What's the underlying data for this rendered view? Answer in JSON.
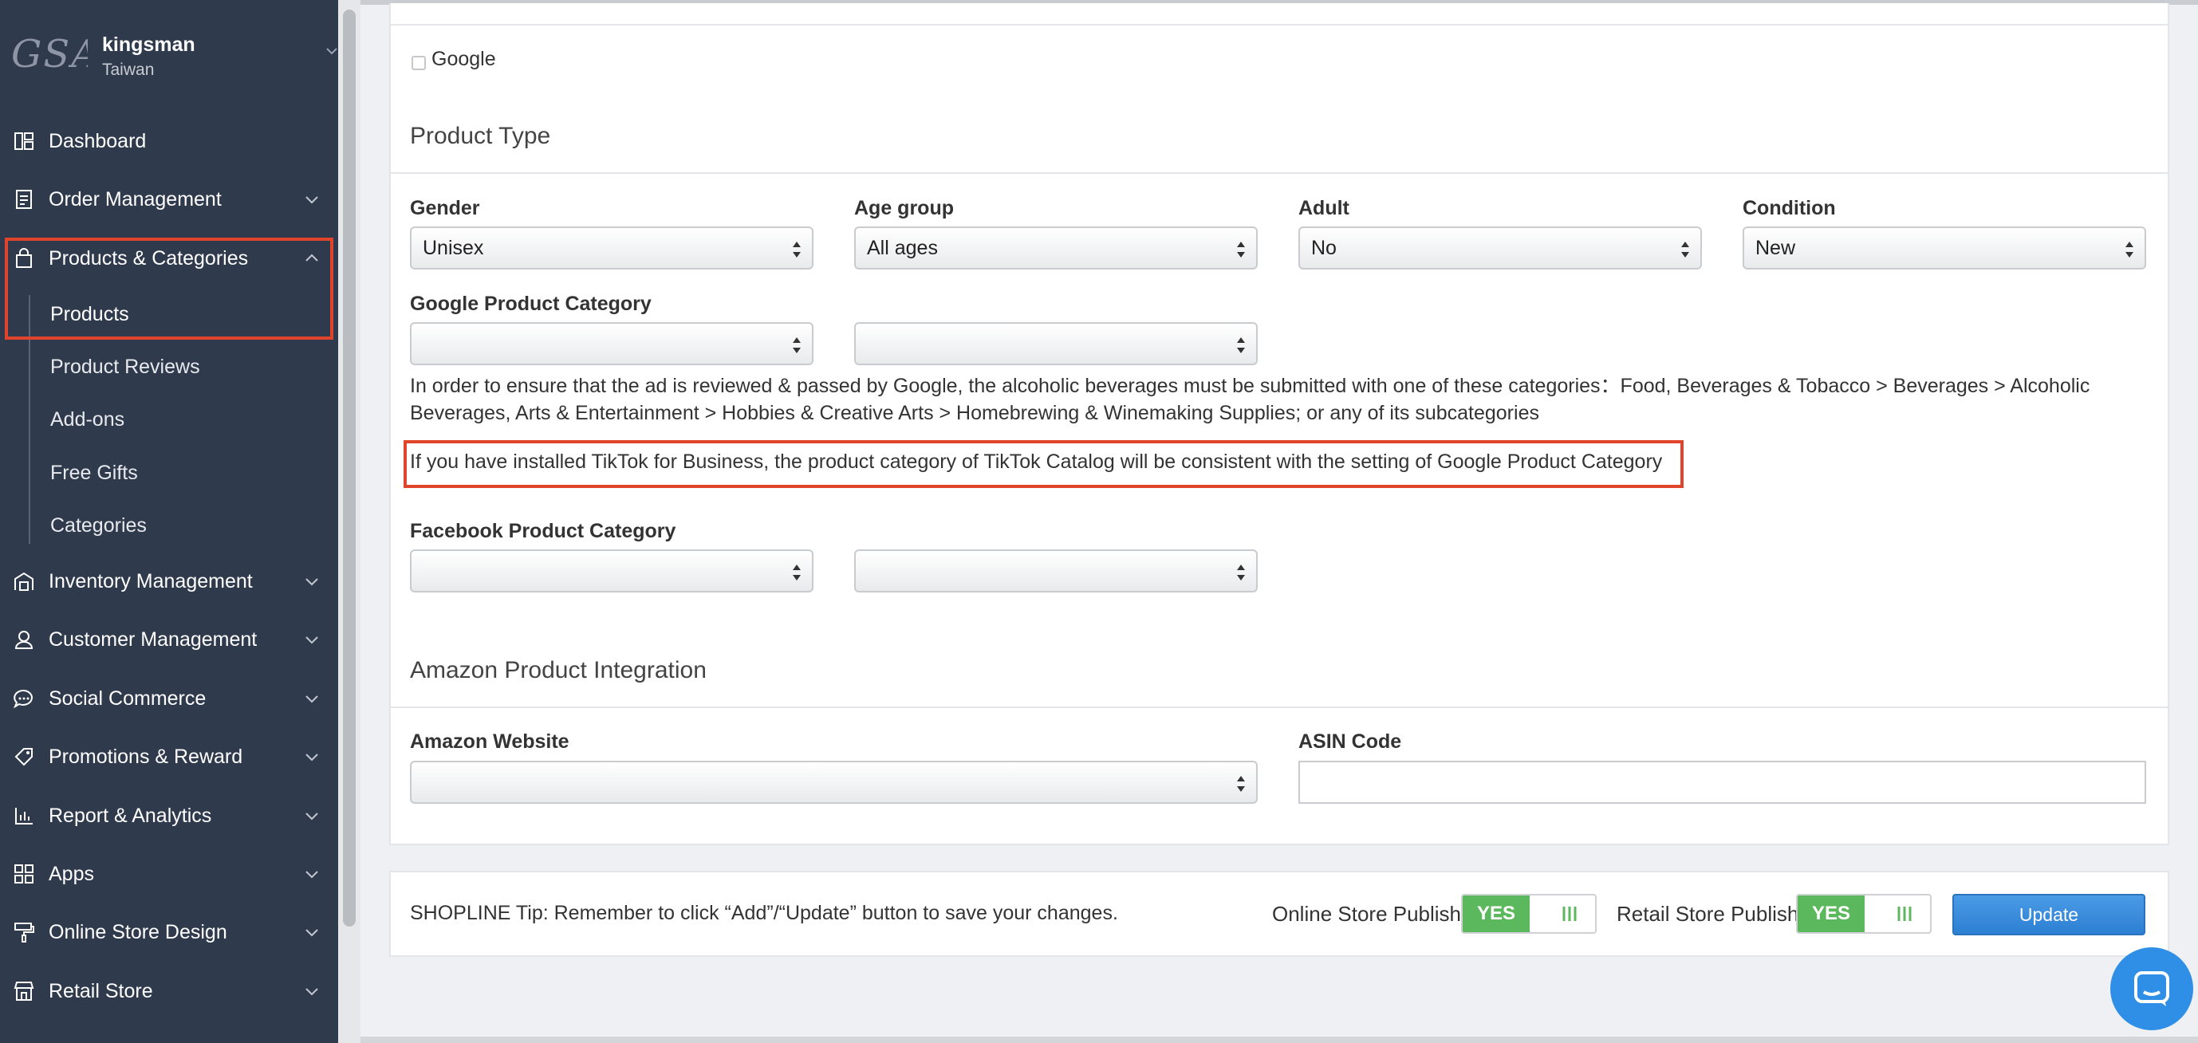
{
  "store": {
    "logo_text": "GSA",
    "name": "kingsman",
    "region": "Taiwan"
  },
  "sidebar": {
    "items": [
      {
        "label": "Dashboard",
        "icon": "dashboard-icon"
      },
      {
        "label": "Order Management",
        "icon": "clipboard-icon"
      },
      {
        "label": "Products & Categories",
        "icon": "shopping-bag-icon"
      },
      {
        "label": "Inventory Management",
        "icon": "warehouse-icon"
      },
      {
        "label": "Customer Management",
        "icon": "user-icon"
      },
      {
        "label": "Social Commerce",
        "icon": "chat-icon"
      },
      {
        "label": "Promotions & Reward",
        "icon": "tag-icon"
      },
      {
        "label": "Report & Analytics",
        "icon": "chart-icon"
      },
      {
        "label": "Apps",
        "icon": "apps-icon"
      },
      {
        "label": "Online Store Design",
        "icon": "paint-roller-icon"
      },
      {
        "label": "Retail Store",
        "icon": "store-icon"
      }
    ],
    "subitems": [
      "Products",
      "Product Reviews",
      "Add-ons",
      "Free Gifts",
      "Categories"
    ]
  },
  "channels": {
    "google_label": "Google"
  },
  "product_type": {
    "title": "Product Type",
    "gender": {
      "label": "Gender",
      "value": "Unisex"
    },
    "age_group": {
      "label": "Age group",
      "value": "All ages"
    },
    "adult": {
      "label": "Adult",
      "value": "No"
    },
    "condition": {
      "label": "Condition",
      "value": "New"
    },
    "google_category": {
      "label": "Google Product Category",
      "help": "In order to ensure that the ad is reviewed & passed by Google, the alcoholic beverages must be submitted with one of these categories：Food, Beverages & Tobacco > Beverages > Alcoholic Beverages, Arts & Entertainment > Hobbies & Creative Arts > Homebrewing & Winemaking Supplies; or any of its subcategories",
      "tiktok_note": "If you have installed TikTok for Business, the product category of TikTok Catalog will be consistent with the setting of Google Product Category"
    },
    "facebook_category": {
      "label": "Facebook Product Category"
    }
  },
  "amazon": {
    "title": "Amazon Product Integration",
    "website_label": "Amazon Website",
    "asin_label": "ASIN Code",
    "asin_value": ""
  },
  "footer": {
    "tip": "SHOPLINE Tip: Remember to click “Add”/“Update” button to save your changes.",
    "online_publish_label": "Online Store Publish",
    "online_publish_state": "YES",
    "retail_publish_label": "Retail Store Publish",
    "retail_publish_state": "YES",
    "update_label": "Update"
  },
  "colors": {
    "sidebar_bg": "#2f3a4c",
    "highlight": "#e0442b",
    "toggle_on": "#5cb85c",
    "primary": "#2d7fd2"
  }
}
